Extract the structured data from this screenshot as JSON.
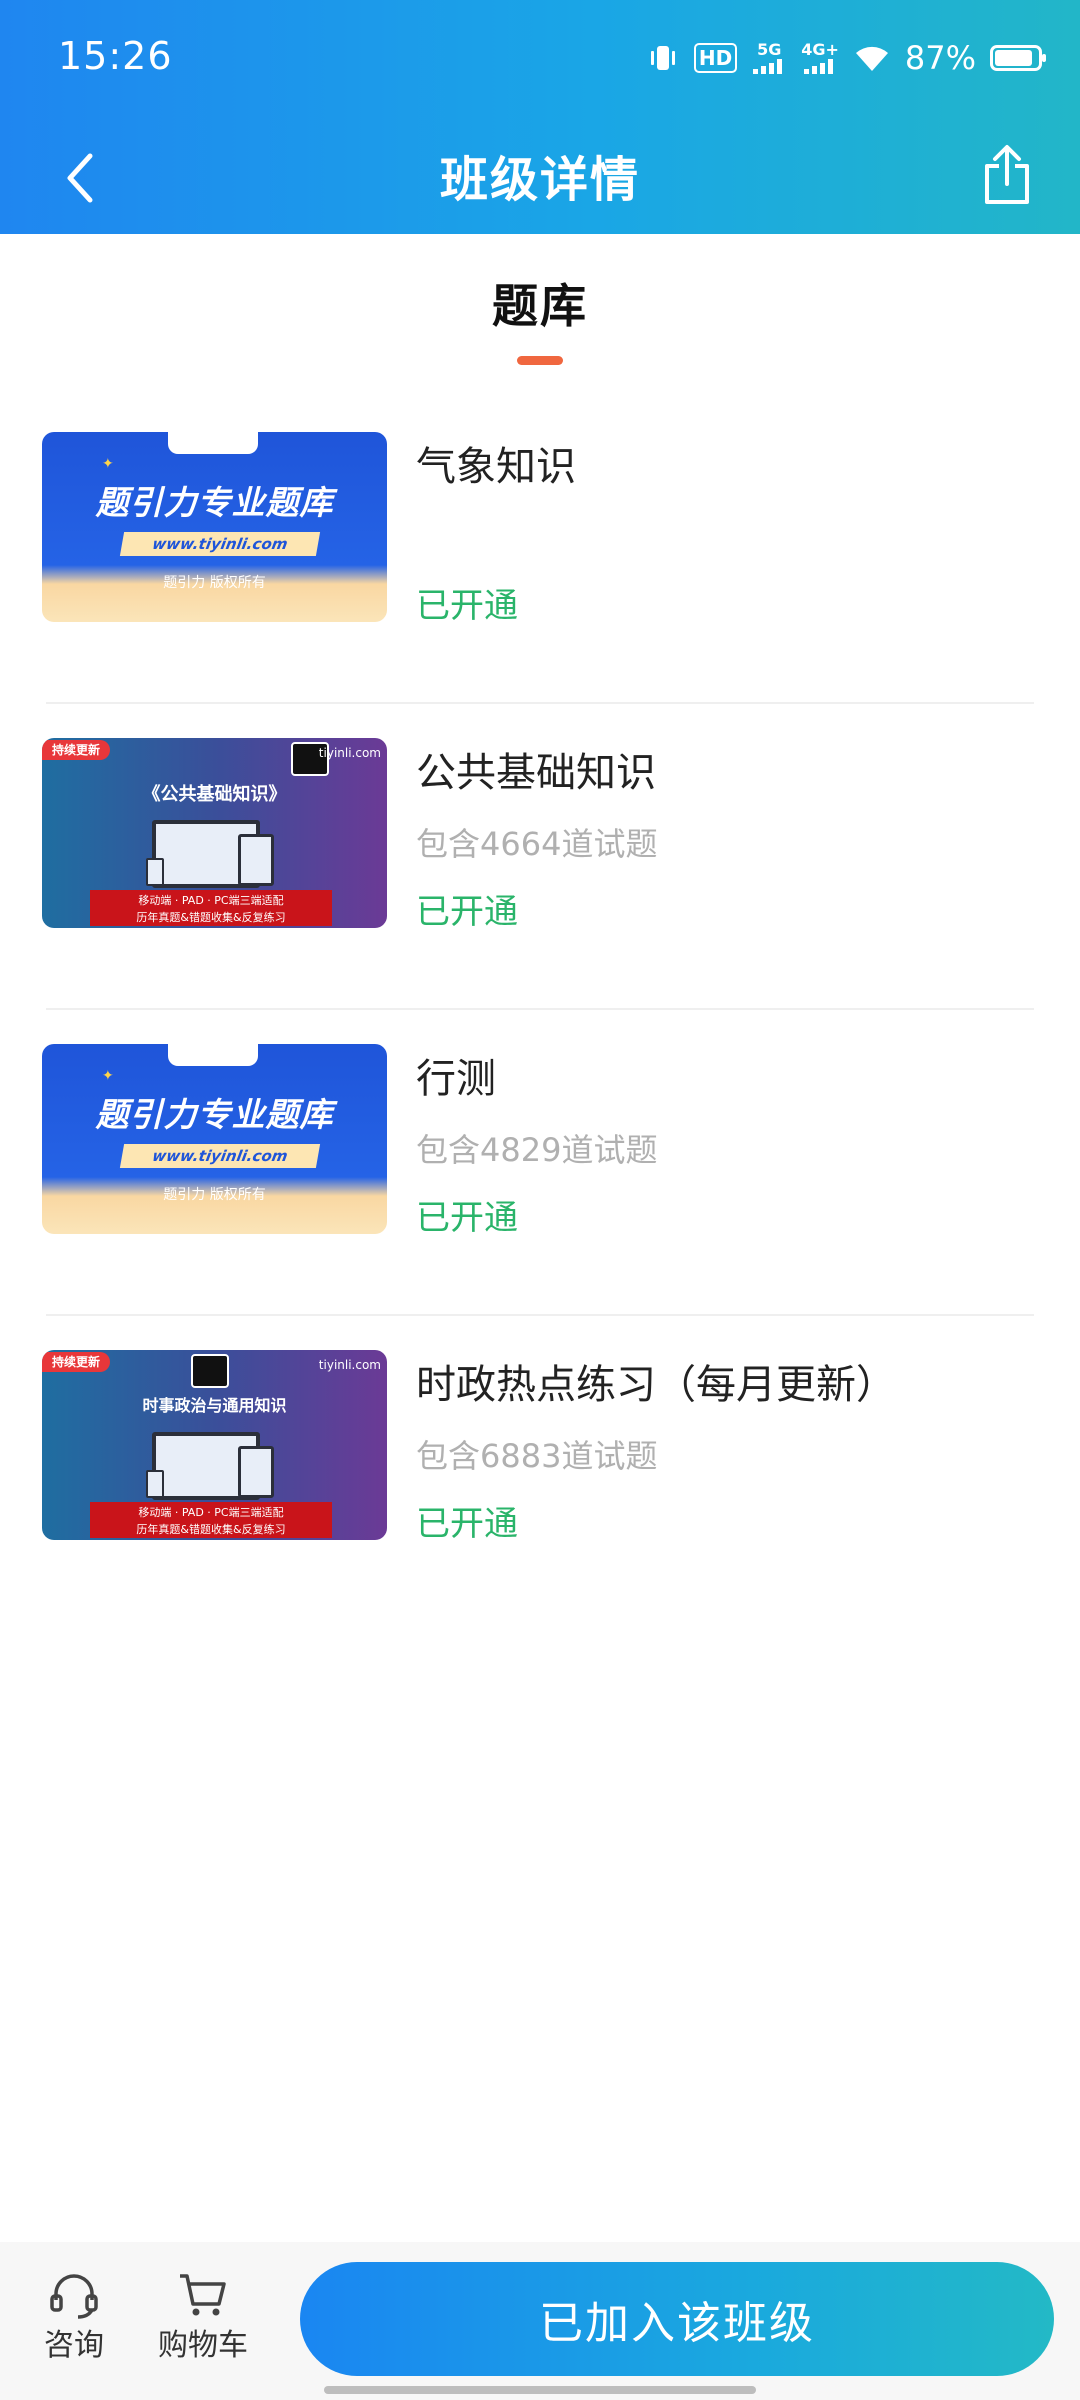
{
  "status": {
    "time": "15:26",
    "network_hd": "HD",
    "network_5g": "5G",
    "network_4g": "4G+",
    "battery": "87%"
  },
  "header": {
    "title": "班级详情",
    "icons": {
      "back": "chevron-left-icon",
      "share": "share-icon"
    }
  },
  "section": {
    "title": "题库"
  },
  "thumbs": {
    "blue_main": "题引力专业题库",
    "blue_url": "www.tiyinli.com",
    "blue_copy": "题引力 版权所有",
    "badge": "持续更新",
    "site": "tiyinli.com",
    "headline_1": "《公共基础知识》",
    "headline_2": "时事政治与通用知识",
    "foot_line1": "移动端 · PAD · PC端三端适配",
    "foot_line2": "历年真题&错题收集&反复练习"
  },
  "items": [
    {
      "title": "气象知识",
      "sub": "",
      "status": "已开通"
    },
    {
      "title": "公共基础知识",
      "sub": "包含4664道试题",
      "status": "已开通"
    },
    {
      "title": "行测",
      "sub": "包含4829道试题",
      "status": "已开通"
    },
    {
      "title": "时政热点练习（每月更新）",
      "sub": "包含6883道试题",
      "status": "已开通"
    }
  ],
  "bottom": {
    "consult_label": "咨询",
    "cart_label": "购物车",
    "join_label": "已加入该班级"
  },
  "colors": {
    "accent": "#1aa6e6",
    "status_green": "#2ab46a",
    "tab_underline": "#f0673f"
  }
}
